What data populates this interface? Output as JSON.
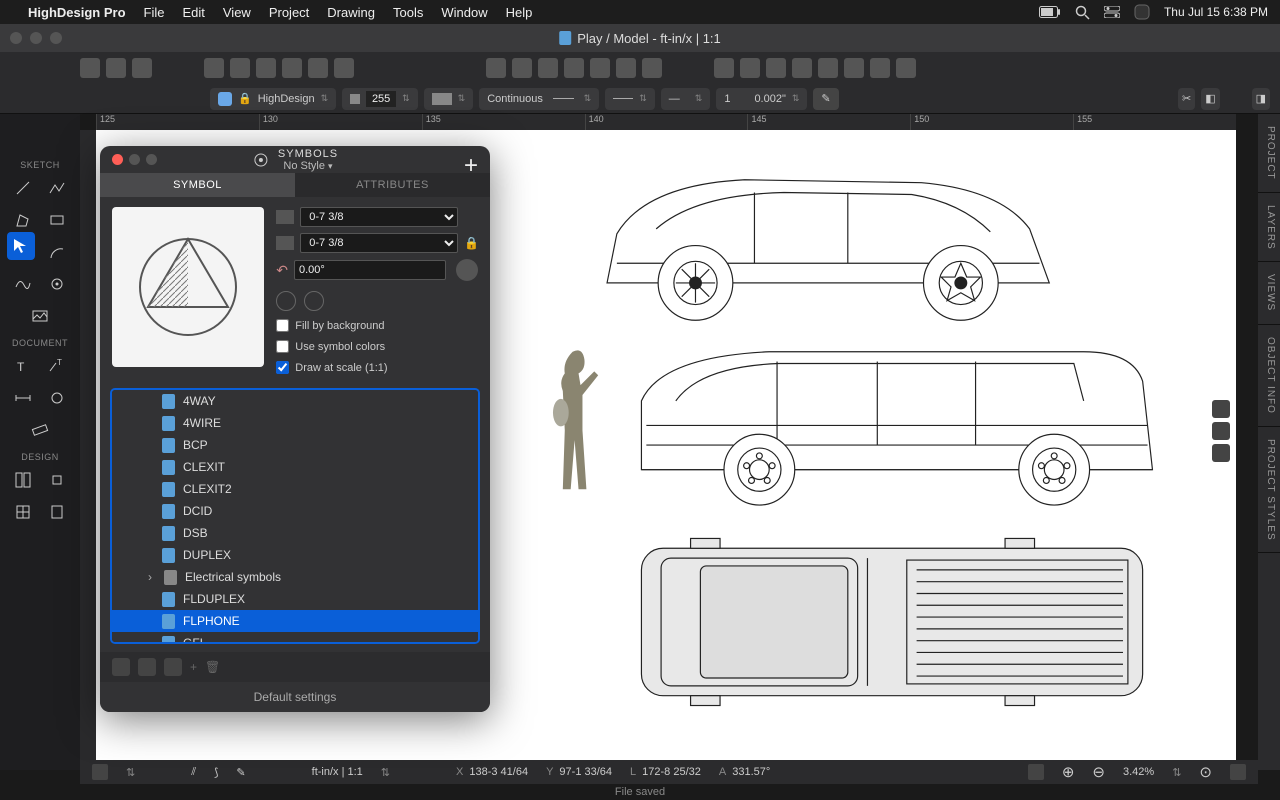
{
  "menubar": {
    "app": "HighDesign Pro",
    "items": [
      "File",
      "Edit",
      "View",
      "Project",
      "Drawing",
      "Tools",
      "Window",
      "Help"
    ],
    "clock": "Thu Jul 15  6:38 PM"
  },
  "window": {
    "title": "Play / Model - ft-in/x | 1:1"
  },
  "propbar": {
    "layer": "HighDesign",
    "opacity": "255",
    "linetype": "Continuous",
    "weight": "1",
    "thickness": "0.002\""
  },
  "ruler": {
    "marks": [
      "125",
      "130",
      "135",
      "140",
      "145",
      "150",
      "155"
    ]
  },
  "left": {
    "sections": [
      "SKETCH",
      "DOCUMENT",
      "DESIGN"
    ]
  },
  "panel": {
    "title": "SYMBOLS",
    "subtitle": "No Style",
    "tabs": {
      "a": "SYMBOL",
      "b": "ATTRIBUTES"
    },
    "width": "0-7 3/8",
    "height": "0-7 3/8",
    "angle": "0.00°",
    "check1": "Fill by background",
    "check2": "Use symbol colors",
    "check3": "Draw at scale (1:1)",
    "defaults": "Default settings",
    "items": [
      {
        "label": "4WAY",
        "type": "file"
      },
      {
        "label": "4WIRE",
        "type": "file"
      },
      {
        "label": "BCP",
        "type": "file"
      },
      {
        "label": "CLEXIT",
        "type": "file"
      },
      {
        "label": "CLEXIT2",
        "type": "file"
      },
      {
        "label": "DCID",
        "type": "file"
      },
      {
        "label": "DSB",
        "type": "file"
      },
      {
        "label": "DUPLEX",
        "type": "file"
      },
      {
        "label": "Electrical symbols",
        "type": "folder"
      },
      {
        "label": "FLDUPLEX",
        "type": "file"
      },
      {
        "label": "FLPHONE",
        "type": "file",
        "selected": true
      },
      {
        "label": "GFI",
        "type": "file"
      }
    ]
  },
  "right_tabs": [
    "PROJECT",
    "LAYERS",
    "VIEWS",
    "OBJECT INFO",
    "PROJECT STYLES"
  ],
  "status": {
    "scale": "ft-in/x | 1:1",
    "x": "138-3 41/64",
    "y": "97-1 33/64",
    "l": "172-8 25/32",
    "a": "331.57°",
    "zoom": "3.42%",
    "file": "File saved"
  }
}
